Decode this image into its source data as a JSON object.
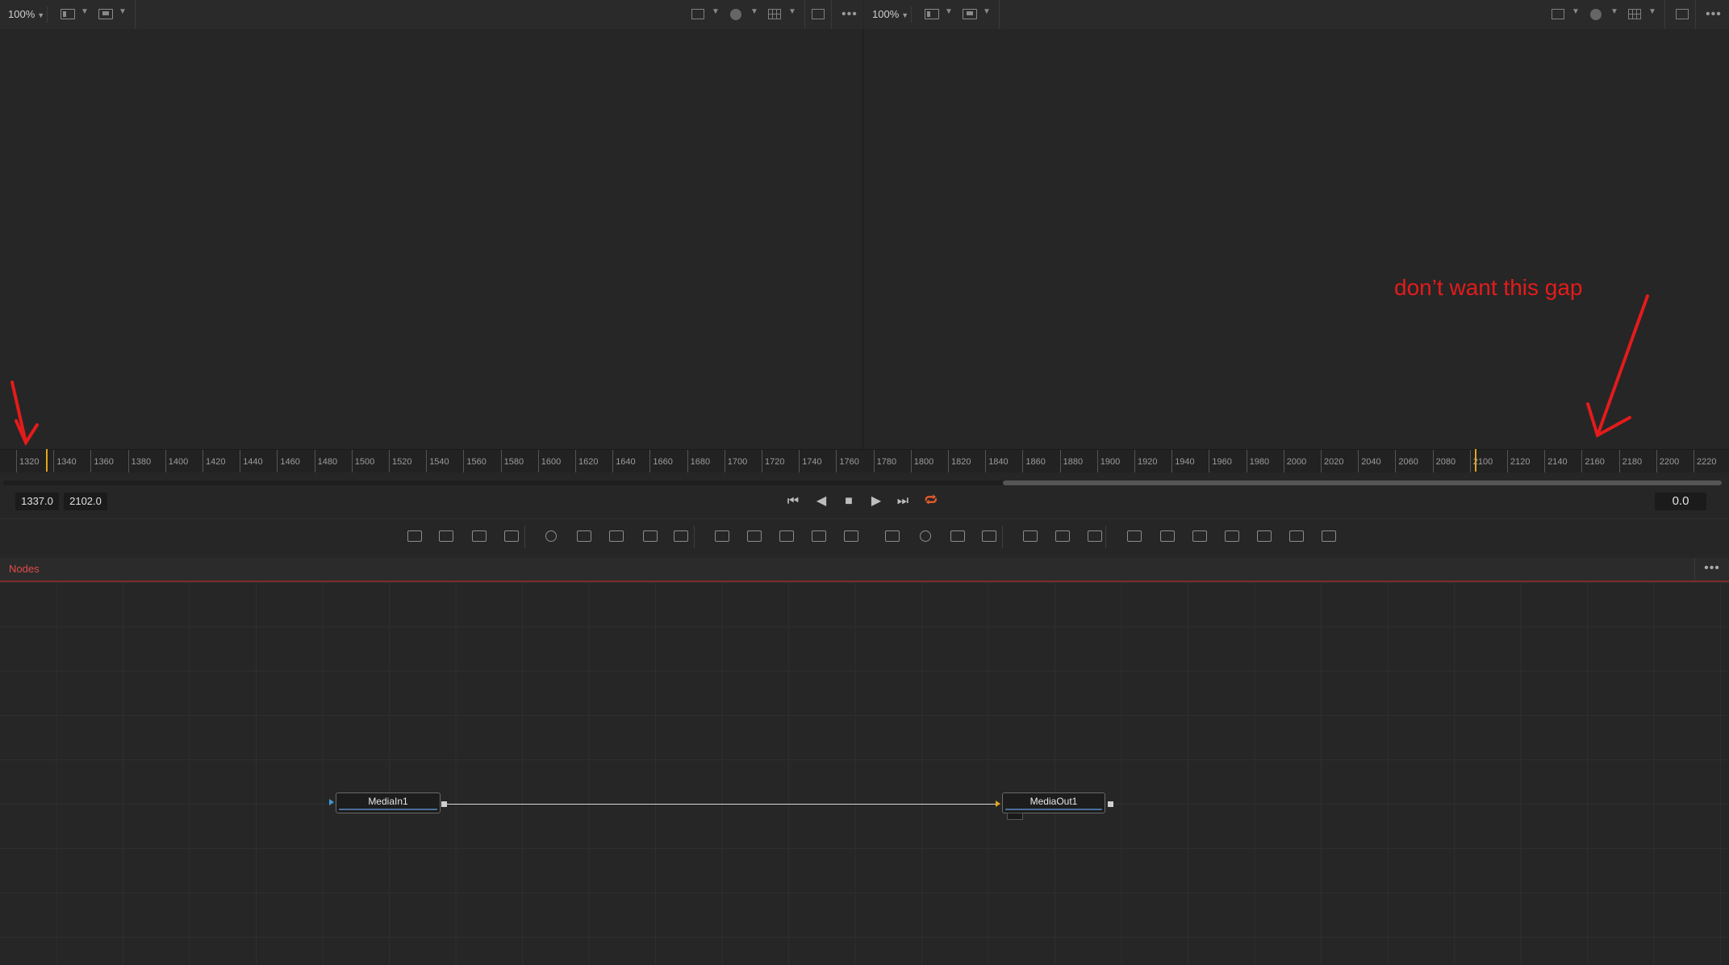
{
  "viewer_left": {
    "zoom": "100%"
  },
  "viewer_right": {
    "zoom": "100%"
  },
  "ruler": {
    "ticks": [
      "1320",
      "1340",
      "1360",
      "1380",
      "1400",
      "1420",
      "1440",
      "1460",
      "1480",
      "1500",
      "1520",
      "1540",
      "1560",
      "1580",
      "1600",
      "1620",
      "1640",
      "1660",
      "1680",
      "1700",
      "1720",
      "1740",
      "1760",
      "1780",
      "1800",
      "1820",
      "1840",
      "1860",
      "1880",
      "1900",
      "1920",
      "1940",
      "1960",
      "1980",
      "2000",
      "2020",
      "2040",
      "2060",
      "2080",
      "2100",
      "2120",
      "2140",
      "2160",
      "2180",
      "2200",
      "2220"
    ]
  },
  "transport": {
    "range_start": "1337.0",
    "range_end": "2102.0",
    "current_time": "0.0",
    "icons": [
      "skip-to-start-icon",
      "step-back-icon",
      "stop-icon",
      "play-icon",
      "skip-to-end-icon",
      "loop-icon"
    ]
  },
  "nodes_panel": {
    "title": "Nodes",
    "more": "•••"
  },
  "nodes": [
    {
      "id": "media-in",
      "label": "MediaIn1"
    },
    {
      "id": "media-out",
      "label": "MediaOut1"
    }
  ],
  "annotation": {
    "text": "don’t want this gap",
    "color": "#e41b1b"
  },
  "colors": {
    "accent": "#e44b4b",
    "playhead": "#e0a51c",
    "loop": "#e35a2b"
  }
}
